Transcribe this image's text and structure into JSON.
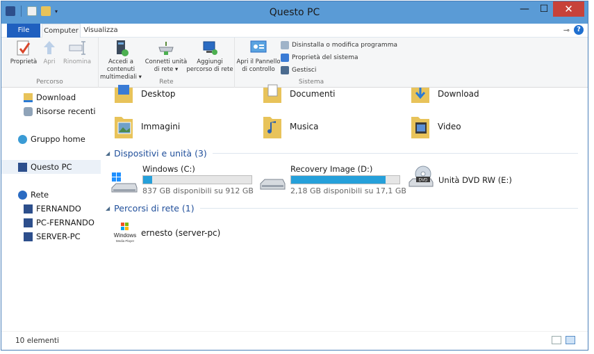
{
  "window": {
    "title": "Questo PC"
  },
  "window_controls": {
    "minimize": "—",
    "maximize": "☐",
    "close": "✕"
  },
  "ribbon": {
    "tabs": [
      {
        "label": "File"
      },
      {
        "label": "Computer"
      },
      {
        "label": "Visualizza"
      }
    ],
    "help": "?",
    "groups": {
      "percorso": {
        "label": "Percorso",
        "buttons": [
          {
            "label": "Proprietà"
          },
          {
            "label": "Apri"
          },
          {
            "label": "Rinomina"
          }
        ]
      },
      "rete": {
        "label": "Rete",
        "buttons": [
          {
            "line1": "Accedi a contenuti",
            "line2": "multimediali ▾"
          },
          {
            "line1": "Connetti unità",
            "line2": "di rete ▾"
          },
          {
            "line1": "Aggiungi",
            "line2": "percorso di rete"
          }
        ]
      },
      "sistema": {
        "label": "Sistema",
        "big_button": {
          "line1": "Apri il Pannello",
          "line2": "di controllo"
        },
        "small_buttons": [
          {
            "label": "Disinstalla o modifica programma"
          },
          {
            "label": "Proprietà del sistema"
          },
          {
            "label": "Gestisci"
          }
        ]
      }
    }
  },
  "nav": {
    "items": [
      {
        "label": "Download"
      },
      {
        "label": "Risorse recenti"
      },
      {
        "label": "Gruppo home"
      },
      {
        "label": "Questo PC"
      },
      {
        "label": "Rete"
      },
      {
        "label": "FERNANDO"
      },
      {
        "label": "PC-FERNANDO"
      },
      {
        "label": "SERVER-PC"
      }
    ]
  },
  "folders": [
    {
      "label": "Desktop"
    },
    {
      "label": "Documenti"
    },
    {
      "label": "Download"
    },
    {
      "label": "Immagini"
    },
    {
      "label": "Musica"
    },
    {
      "label": "Video"
    }
  ],
  "sections": {
    "devices": "Dispositivi e unità (3)",
    "network": "Percorsi di rete (1)"
  },
  "drives": [
    {
      "name": "Windows (C:)",
      "free": "837 GB disponibili su 912 GB",
      "used_fraction": 0.082
    },
    {
      "name": "Recovery Image (D:)",
      "free": "2,18 GB disponibili su 17,1 GB",
      "used_fraction": 0.873
    },
    {
      "name": "Unità DVD RW (E:)"
    }
  ],
  "dvd_label": "DVD",
  "network_locations": [
    {
      "label": "ernesto (server-pc)",
      "logo_text": "Windows",
      "logo_sub": "Media Player"
    }
  ],
  "status": {
    "text": "10 elementi"
  },
  "colors": {
    "accent": "#1f5fbf",
    "titlebar": "#5a9bd6",
    "drive_fill": "#26a0da",
    "close": "#c7423a"
  }
}
